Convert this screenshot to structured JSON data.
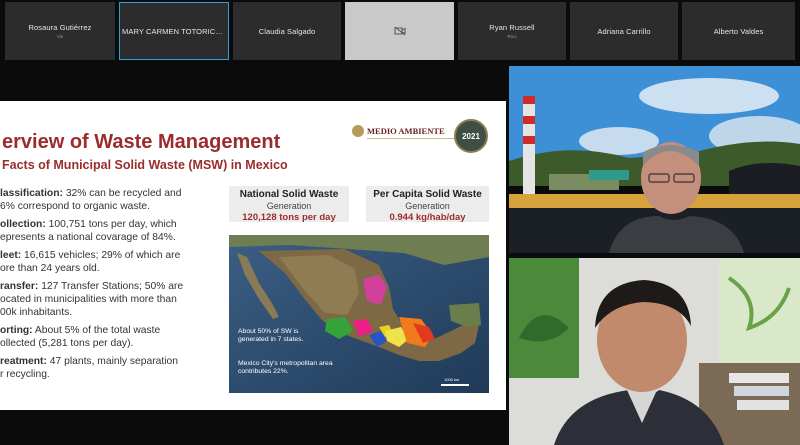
{
  "participants": [
    {
      "name": "Rosaura Gutiérrez",
      "sub": "Vis"
    },
    {
      "name": "MARY CARMEN TOTORICAG...",
      "sub": ""
    },
    {
      "name": "Claudia Salgado",
      "sub": ""
    },
    {
      "name": "",
      "sub": ""
    },
    {
      "name": "Ryan Russell",
      "sub": "Rico"
    },
    {
      "name": "Adriana Carrillo",
      "sub": ""
    },
    {
      "name": "Alberto Valdes",
      "sub": ""
    }
  ],
  "slide": {
    "title": "erview of Waste Management",
    "subtitle": "Facts of Municipal Solid Waste (MSW) in Mexico",
    "logo_text": "MEDIO AMBIENTE",
    "seal_text": "2021",
    "bullets": [
      {
        "label": "lassification:",
        "lines": [
          " 32% can be recycled and",
          "6% correspond to organic waste."
        ]
      },
      {
        "label": "ollection:",
        "lines": [
          " 100,751 tons per day, which",
          "epresents a national covarage of 84%."
        ]
      },
      {
        "label": "leet:",
        "lines": [
          " 16,615 vehicles; 29% of which are",
          "ore than 24 years old."
        ]
      },
      {
        "label": "ransfer:",
        "lines": [
          " 127 Transfer Stations; 50% are",
          "ocated in municipalities with more than",
          "00k inhabitants."
        ]
      },
      {
        "label": "orting:",
        "lines": [
          " About 5% of the total waste",
          "ollected (5,281 tons per day)."
        ]
      },
      {
        "label": "reatment:",
        "lines": [
          " 47 plants, mainly separation",
          "r recycling."
        ]
      }
    ],
    "stats": [
      {
        "heading": "National Solid Waste",
        "gen": "Generation",
        "value": "120,128 tons per day"
      },
      {
        "heading": "Per Capita Solid Waste",
        "gen": "Generation",
        "value": "0.944 kg/hab/day"
      }
    ],
    "map": {
      "note1": "About 50% of SW is generated in 7 states.",
      "note2": "Mexico City's metropolitan area contributes 22%.",
      "scale": "1000 km"
    }
  }
}
